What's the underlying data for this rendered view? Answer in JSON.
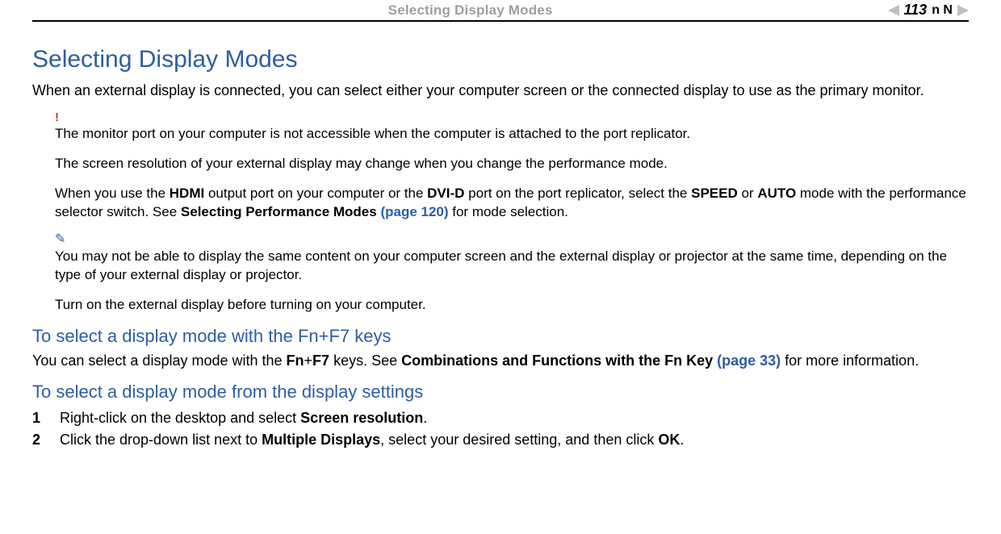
{
  "header": {
    "title": "Selecting Display Modes",
    "navN": "n N",
    "page": "113"
  },
  "main": {
    "heading": "Selecting Display Modes",
    "intro": "When an external display is connected, you can select either your computer screen or the connected display to use as the primary monitor."
  },
  "note_warn": {
    "p1": "The monitor port on your computer is not accessible when the computer is attached to the port replicator.",
    "p2": "The screen resolution of your external display may change when you change the performance mode.",
    "p3_a": "When you use the ",
    "p3_hdmi": "HDMI",
    "p3_b": " output port on your computer or the ",
    "p3_dvid": "DVI-D",
    "p3_c": " port on the port replicator, select the ",
    "p3_speed": "SPEED",
    "p3_d": " or ",
    "p3_auto": "AUTO",
    "p3_e": " mode with the performance selector switch. See ",
    "p3_link_label": "Selecting Performance Modes",
    "p3_link_page": " (page 120)",
    "p3_f": " for mode selection."
  },
  "note_tip": {
    "p1": "You may not be able to display the same content on your computer screen and the external display or projector at the same time, depending on the type of your external display or projector.",
    "p2": "Turn on the external display before turning on your computer."
  },
  "section1": {
    "heading": "To select a display mode with the Fn+F7 keys",
    "body_a": "You can select a display mode with the ",
    "body_fn": "Fn",
    "body_plus": "+",
    "body_f7": "F7",
    "body_b": " keys. See ",
    "body_link_label": "Combinations and Functions with the Fn Key",
    "body_link_page": " (page 33)",
    "body_c": " for more information."
  },
  "section2": {
    "heading": "To select a display mode from the display settings",
    "steps": {
      "s1_num": "1",
      "s1_a": "Right-click on the desktop and select ",
      "s1_b": "Screen resolution",
      "s1_c": ".",
      "s2_num": "2",
      "s2_a": "Click the drop-down list next to ",
      "s2_b": "Multiple Displays",
      "s2_c": ", select your desired setting, and then click ",
      "s2_d": "OK",
      "s2_e": "."
    }
  }
}
